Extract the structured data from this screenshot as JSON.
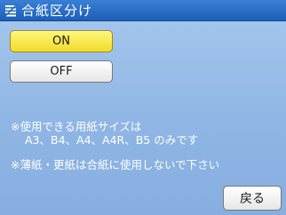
{
  "title": "合紙区分け",
  "options": {
    "on_label": "ON",
    "off_label": "OFF",
    "selected": "ON"
  },
  "notes": {
    "line1": "※使用できる用紙サイズは",
    "line1b": "A3、B4、A4、A4R、B5 のみです",
    "line2": "※薄紙・更紙は合紙に使用しないで下さい"
  },
  "back_label": "戻る",
  "icon": "paper-stack-icon",
  "colors": {
    "title_bar": "#1d5fb8",
    "selected_button": "#f0dc2c",
    "background": "#8fb6e4"
  }
}
